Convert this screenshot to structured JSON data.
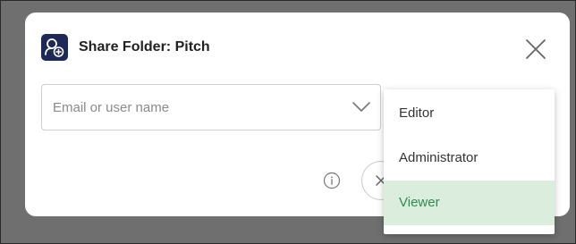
{
  "dialog": {
    "title": "Share Folder: Pitch",
    "icon": "user-add-icon",
    "close_icon": "close-icon"
  },
  "email_field": {
    "value": "",
    "placeholder": "Email or user name",
    "chevron_icon": "chevron-down-icon"
  },
  "footer": {
    "info_icon": "info-icon",
    "cancel_icon": "close-icon"
  },
  "role_menu": {
    "options": [
      "Editor",
      "Administrator",
      "Viewer"
    ],
    "selected": "Viewer"
  },
  "colors": {
    "accent": "#2f8a4d",
    "selected_background": "#dbeedd",
    "icon_background": "#1e2a55"
  }
}
